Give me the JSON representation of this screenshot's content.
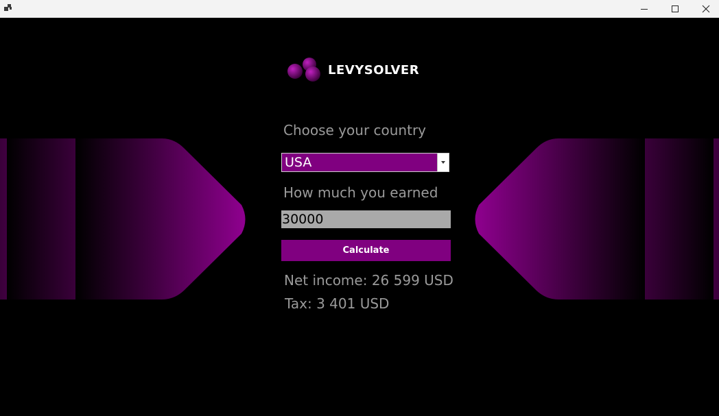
{
  "window": {
    "controls": {
      "minimize_icon": "minimize-icon",
      "maximize_icon": "maximize-icon",
      "close_icon": "close-icon"
    }
  },
  "app": {
    "logo_text": "LEVYSOLVER"
  },
  "form": {
    "country_label": "Choose your country",
    "country_value": "USA",
    "earned_label": "How much you earned",
    "earned_value": "30000",
    "calculate_label": "Calculate"
  },
  "results": {
    "net_income": "Net income: 26 599 USD",
    "tax": "Tax: 3 401 USD"
  },
  "colors": {
    "accent": "#800080",
    "background": "#000000",
    "label_text": "#9a9a9a",
    "input_background": "#a9a9a9"
  }
}
